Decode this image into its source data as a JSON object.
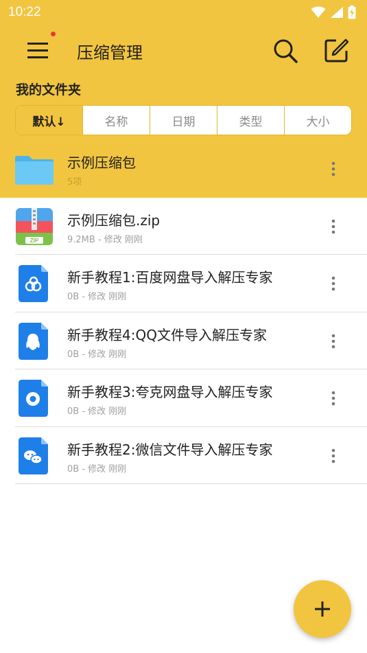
{
  "status_bar": {
    "time": "10:22",
    "icons": [
      "wifi-icon",
      "signal-icon",
      "battery-charging-icon"
    ]
  },
  "app_bar": {
    "title": "压缩管理",
    "menu_icon": "hamburger-menu-icon",
    "search_icon": "search-icon",
    "edit_icon": "edit-icon"
  },
  "section": {
    "title": "我的文件夹"
  },
  "sort_tabs": [
    {
      "label": "默认↓",
      "active": true
    },
    {
      "label": "名称",
      "active": false
    },
    {
      "label": "日期",
      "active": false
    },
    {
      "label": "类型",
      "active": false
    },
    {
      "label": "大小",
      "active": false
    }
  ],
  "files": [
    {
      "name": "示例压缩包",
      "meta": "5项",
      "icon": "folder-icon",
      "selected": true
    },
    {
      "name": "示例压缩包.zip",
      "meta": "9.2MB - 修改 刚刚",
      "icon": "zip-file-icon",
      "zip_badge": "ZIP"
    },
    {
      "name": "新手教程1:百度网盘导入解压专家",
      "meta": "0B - 修改 刚刚",
      "icon": "baidu-netdisk-doc-icon"
    },
    {
      "name": "新手教程4:QQ文件导入解压专家",
      "meta": "0B - 修改 刚刚",
      "icon": "qq-doc-icon"
    },
    {
      "name": "新手教程3:夸克网盘导入解压专家",
      "meta": "0B - 修改 刚刚",
      "icon": "quark-doc-icon"
    },
    {
      "name": "新手教程2:微信文件导入解压专家",
      "meta": "0B - 修改 刚刚",
      "icon": "wechat-doc-icon"
    }
  ],
  "fab": {
    "label": "+",
    "icon": "plus-icon"
  },
  "colors": {
    "accent": "#f2c540",
    "folder": "#5bc0f0",
    "doc_blue": "#1e7fe8",
    "zip_red": "#f2545b",
    "zip_green": "#7cc24a"
  }
}
